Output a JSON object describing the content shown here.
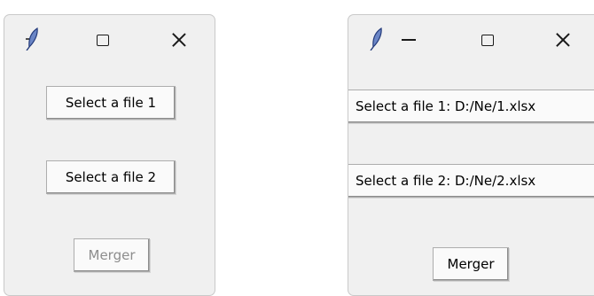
{
  "window1": {
    "buttons": {
      "select_file_1": "Select a file 1",
      "select_file_2": "Select a file 2",
      "merger": "Merger"
    }
  },
  "window2": {
    "buttons": {
      "select_file_1": "Select a file 1: D:/Ne/1.xlsx",
      "select_file_2": "Select a file 2: D:/Ne/2.xlsx",
      "merger": "Merger"
    }
  },
  "icons": {
    "app": "feather-icon",
    "minimize": "minimize-icon",
    "maximize": "maximize-icon",
    "close": "close-icon"
  },
  "colors": {
    "window_bg": "#f0f0f0",
    "button_bg": "#fafafa",
    "disabled_text": "#8d8d8d",
    "feather": "#6b86c6"
  }
}
